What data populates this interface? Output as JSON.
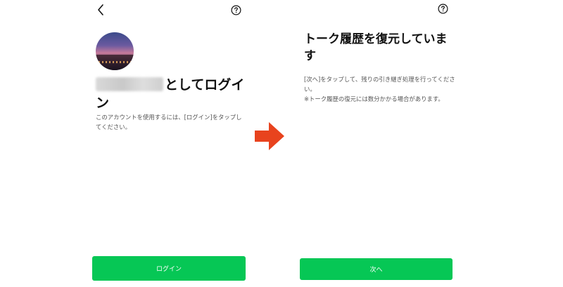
{
  "left": {
    "title_suffix": "としてログイン",
    "description": "このアカウントを使用するには、[ログイン]をタップしてください。",
    "login_button": "ログイン"
  },
  "right": {
    "title": "トーク履歴を復元しています",
    "description_line1": "[次へ]をタップして、残りの引き継ぎ処理を行ってください。",
    "description_line2": "※トーク履歴の復元には数分かかる場合があります。",
    "next_button": "次へ"
  },
  "colors": {
    "accent_green": "#06c755",
    "arrow_red": "#e8431e"
  },
  "icons": {
    "back": "chevron-left-icon",
    "help": "question-circle-icon",
    "flow": "arrow-right-icon"
  }
}
